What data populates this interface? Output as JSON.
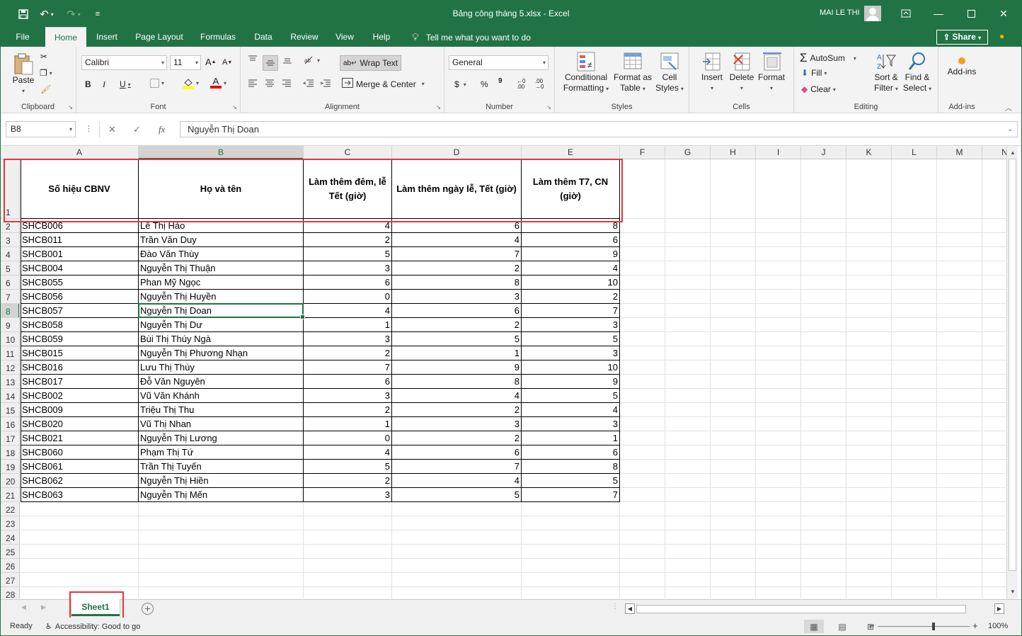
{
  "window": {
    "title": "Bảng công tháng 5.xlsx  -  Excel",
    "user": "MAI LE THI"
  },
  "tabs": [
    "File",
    "Home",
    "Insert",
    "Page Layout",
    "Formulas",
    "Data",
    "Review",
    "View",
    "Help"
  ],
  "active_tab": "Home",
  "tell_me": "Tell me what you want to do",
  "share_label": "Share",
  "ribbon": {
    "clipboard": {
      "paste": "Paste",
      "label": "Clipboard"
    },
    "font": {
      "name": "Calibri",
      "size": "11",
      "label": "Font",
      "bold": "B",
      "italic": "I",
      "underline": "U",
      "grow": "A",
      "shrink": "A",
      "color_letter": "A"
    },
    "alignment": {
      "wrap_text": "Wrap Text",
      "merge_center": "Merge & Center",
      "label": "Alignment"
    },
    "number": {
      "format": "General",
      "label": "Number",
      "currency": "$",
      "percent": "%",
      "comma": "9",
      "inc_decimal": "←0 .00",
      "dec_decimal": ".00 →0"
    },
    "styles": {
      "conditional_1": "Conditional",
      "conditional_2": "Formatting",
      "format_table_1": "Format as",
      "format_table_2": "Table",
      "cell_styles_1": "Cell",
      "cell_styles_2": "Styles",
      "label": "Styles"
    },
    "cells": {
      "insert": "Insert",
      "delete": "Delete",
      "format": "Format",
      "label": "Cells"
    },
    "editing": {
      "autosum": "AutoSum",
      "fill": "Fill",
      "clear": "Clear",
      "sort_1": "Sort &",
      "sort_2": "Filter",
      "find_1": "Find &",
      "find_2": "Select",
      "label": "Editing"
    },
    "addins": {
      "button": "Add-ins",
      "label": "Add-ins"
    }
  },
  "formula_bar": {
    "name_box": "B8",
    "fx": "fx",
    "formula": "Nguyễn Thị Doan"
  },
  "columns": [
    "A",
    "B",
    "C",
    "D",
    "E",
    "F",
    "G",
    "H",
    "I",
    "J",
    "K",
    "L",
    "M",
    "N"
  ],
  "rows": [
    "1",
    "2",
    "3",
    "4",
    "5",
    "6",
    "7",
    "8",
    "9",
    "10",
    "11",
    "12",
    "13",
    "14",
    "15",
    "16",
    "17",
    "18",
    "19",
    "20",
    "21",
    "22",
    "23",
    "24",
    "25",
    "26",
    "27",
    "28"
  ],
  "sheet": {
    "headers": [
      "Số hiệu CBNV",
      "Họ và tên",
      "Làm thêm đêm, lễ Tết (giờ)",
      "Làm thêm ngày lễ, Tết (giờ)",
      "Làm thêm T7, CN (giờ)"
    ],
    "data": [
      [
        "SHCB006",
        "Lê Thị Hảo",
        "4",
        "6",
        "8"
      ],
      [
        "SHCB011",
        "Trần Văn Duy",
        "2",
        "4",
        "6"
      ],
      [
        "SHCB001",
        "Đào Văn Thùy",
        "5",
        "7",
        "9"
      ],
      [
        "SHCB004",
        "Nguyễn Thị Thuận",
        "3",
        "2",
        "4"
      ],
      [
        "SHCB055",
        "Phan Mỹ Ngọc",
        "6",
        "8",
        "10"
      ],
      [
        "SHCB056",
        "Nguyễn Thị Huyền",
        "0",
        "3",
        "2"
      ],
      [
        "SHCB057",
        "Nguyễn Thị Doan",
        "4",
        "6",
        "7"
      ],
      [
        "SHCB058",
        "Nguyễn Thị Dư",
        "1",
        "2",
        "3"
      ],
      [
        "SHCB059",
        "Bùi Thị Thúy Ngà",
        "3",
        "5",
        "5"
      ],
      [
        "SHCB015",
        "Nguyễn Thị Phương Nhạn",
        "2",
        "1",
        "3"
      ],
      [
        "SHCB016",
        "Lưu Thị Thùy",
        "7",
        "9",
        "10"
      ],
      [
        "SHCB017",
        "Đỗ Văn Nguyên",
        "6",
        "8",
        "9"
      ],
      [
        "SHCB002",
        "Vũ Văn Khánh",
        "3",
        "4",
        "5"
      ],
      [
        "SHCB009",
        "Triệu Thị Thu",
        "2",
        "2",
        "4"
      ],
      [
        "SHCB020",
        "Vũ Thị Nhan",
        "1",
        "3",
        "3"
      ],
      [
        "SHCB021",
        "Nguyễn Thị Lương",
        "0",
        "2",
        "1"
      ],
      [
        "SHCB060",
        "Phạm Thị Tứ",
        "4",
        "6",
        "6"
      ],
      [
        "SHCB061",
        "Trần Thị Tuyến",
        "5",
        "7",
        "8"
      ],
      [
        "SHCB062",
        "Nguyễn Thị Hiền",
        "2",
        "4",
        "5"
      ],
      [
        "SHCB063",
        "Nguyễn Thị Mến",
        "3",
        "5",
        "7"
      ]
    ]
  },
  "sheet_tab": "Sheet1",
  "status": {
    "ready": "Ready",
    "accessibility": "Accessibility: Good to go",
    "zoom": "100%",
    "zoom_out": "−",
    "zoom_in": "+"
  },
  "colors": {
    "accent": "#217346",
    "highlight_box": "#e8353b"
  }
}
